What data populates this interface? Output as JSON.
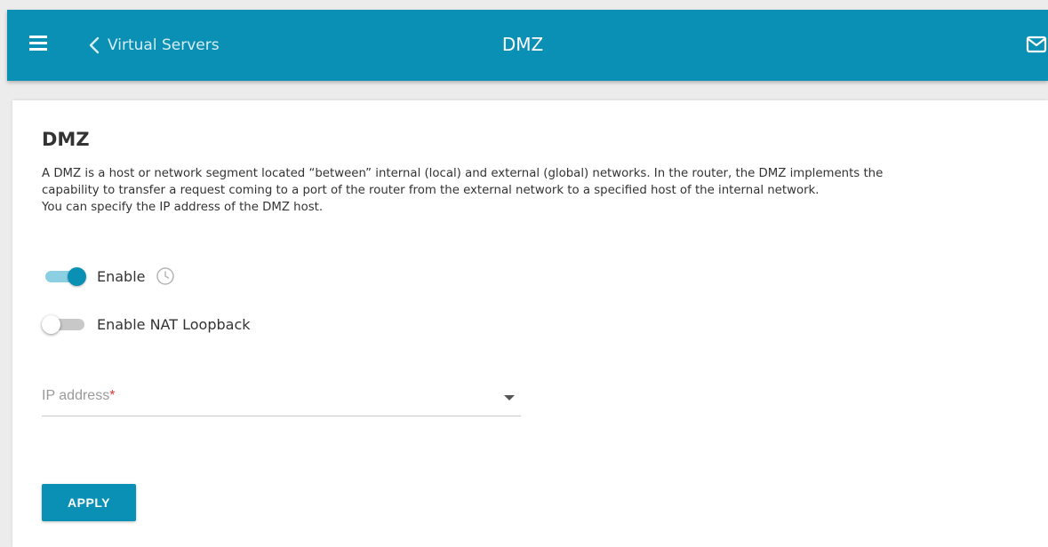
{
  "header": {
    "back_label": "Virtual Servers",
    "title": "DMZ",
    "menu_icon": "hamburger-menu-icon",
    "back_icon": "chevron-left-icon",
    "mail_icon": "mail-icon"
  },
  "section": {
    "title": "DMZ",
    "description": [
      "A DMZ is a host or network segment located “between” internal (local) and external (global) networks. In the router, the DMZ implements the",
      "capability to transfer a request coming to a port of the router from the external network to a specified host of the internal network.",
      "You can specify the IP address of the DMZ host."
    ]
  },
  "toggles": {
    "enable": {
      "label": "Enable",
      "checked": true
    },
    "nat_loopback": {
      "label": "Enable NAT Loopback",
      "checked": false
    }
  },
  "ip_address": {
    "placeholder": "IP address",
    "required_mark": "*",
    "value": ""
  },
  "apply_label": "APPLY",
  "colors": {
    "accent": "#0a8fb5",
    "required": "#e53935"
  }
}
